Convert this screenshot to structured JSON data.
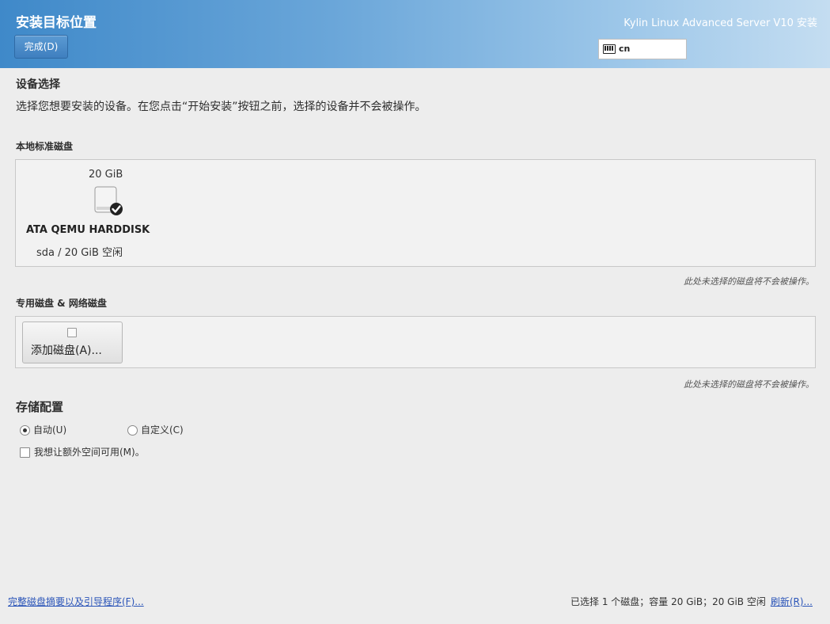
{
  "header": {
    "title": "安装目标位置",
    "done_label": "完成(D)",
    "product": "Kylin Linux Advanced Server V10 安装",
    "keyboard_layout": "cn"
  },
  "device_selection": {
    "title": "设备选择",
    "description": "选择您想要安装的设备。在您点击“开始安装”按钮之前，选择的设备并不会被操作。"
  },
  "local_disks": {
    "title": "本地标准磁盘",
    "disks": [
      {
        "size": "20 GiB",
        "name": "ATA QEMU HARDDISK",
        "detail": "sda  /  20 GiB 空闲",
        "selected": true
      }
    ],
    "note": "此处未选择的磁盘将不会被操作。"
  },
  "special_disks": {
    "title": "专用磁盘 & 网络磁盘",
    "add_button": "添加磁盘(A)...",
    "note": "此处未选择的磁盘将不会被操作。"
  },
  "storage_config": {
    "title": "存储配置",
    "options": [
      {
        "label": "自动(U)",
        "selected": true
      },
      {
        "label": "自定义(C)",
        "selected": false
      }
    ],
    "extra_space_label": "我想让额外空间可用(M)。",
    "extra_space_checked": false
  },
  "footer": {
    "summary_link": "完整磁盘摘要以及引导程序(F)...",
    "status": "已选择 1 个磁盘；容量 20 GiB；20 GiB 空闲",
    "refresh_link": "刷新(R)..."
  },
  "colors": {
    "header_gradient_start": "#3f89c9",
    "header_gradient_end": "#c4ddf1",
    "link": "#2a54b8"
  }
}
